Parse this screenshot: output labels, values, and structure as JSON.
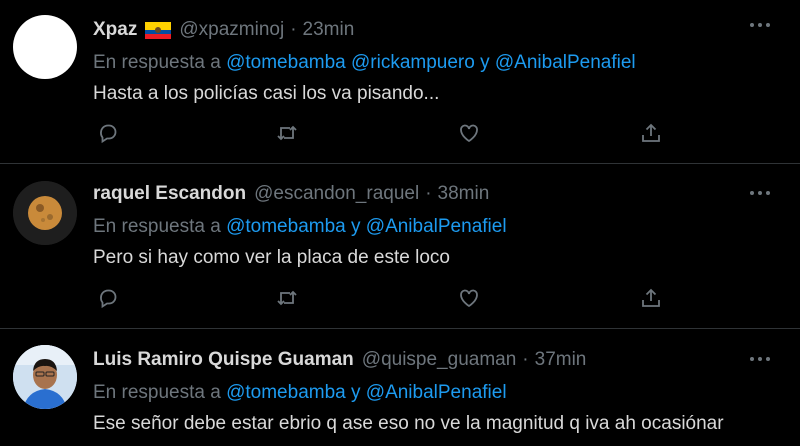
{
  "colors": {
    "background": "#000000",
    "divider": "#2f3336",
    "text": "#d9d9d9",
    "muted": "#6e767d",
    "link": "#1d9bf0"
  },
  "tweets": [
    {
      "name": "Xpaz",
      "flag": "ecuador-flag",
      "handle": "@xpazminoj",
      "separator": "·",
      "time": "23min",
      "reply_prefix": "En respuesta a",
      "mentions": [
        "@tomebamba",
        "@rickampuero",
        "@AnibalPenafiel"
      ],
      "joiner": "y",
      "text": "Hasta a los policías casi los va pisando..."
    },
    {
      "name": "raquel Escandon",
      "handle": "@escandon_raquel",
      "separator": "·",
      "time": "38min",
      "reply_prefix": "En respuesta a",
      "mentions": [
        "@tomebamba",
        "@AnibalPenafiel"
      ],
      "joiner": "y",
      "text": "Pero si hay como ver la placa de este loco"
    },
    {
      "name": "Luis Ramiro Quispe Guaman",
      "handle": "@quispe_guaman",
      "separator": "·",
      "time": "37min",
      "reply_prefix": "En respuesta a",
      "mentions": [
        "@tomebamba",
        "@AnibalPenafiel"
      ],
      "joiner": "y",
      "text": "Ese señor debe estar ebrio q ase eso no ve la magnitud q iva ah ocasiónar"
    }
  ],
  "icons": {
    "reply": "reply-icon",
    "retweet": "retweet-icon",
    "like": "like-icon",
    "share": "share-icon",
    "more": "more-icon"
  }
}
